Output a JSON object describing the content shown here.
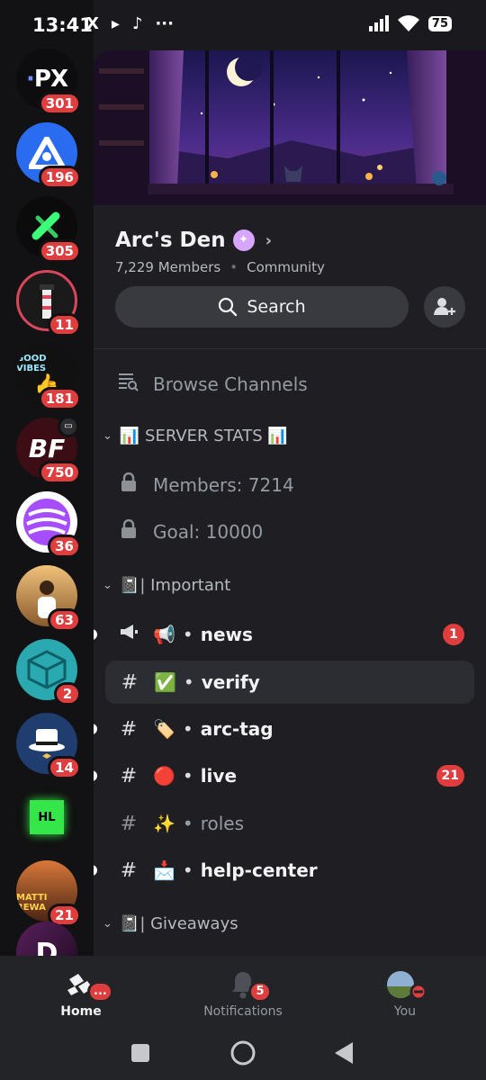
{
  "status_bar": {
    "time": "13:41",
    "left_icons": [
      "X",
      "▸",
      "♪",
      "···"
    ],
    "battery": "75"
  },
  "servers": [
    {
      "name": "server-px",
      "label": "PX",
      "badge": "301",
      "color": "#0d0d10"
    },
    {
      "name": "server-blue-triangle",
      "label": "",
      "badge": "196",
      "color": "#2a6cf0"
    },
    {
      "name": "server-green-x",
      "label": "",
      "badge": "305",
      "color": "#0b0b0b"
    },
    {
      "name": "server-lighthouse",
      "label": "",
      "badge": "11",
      "color": "#1a1a1a"
    },
    {
      "name": "server-good-vibes",
      "label": "GOOD VIBES",
      "badge": "181",
      "color": "#111"
    },
    {
      "name": "server-bf",
      "label": "BF",
      "badge": "750",
      "color": "#3b0d14"
    },
    {
      "name": "server-purple-waves",
      "label": "",
      "badge": "36",
      "color": "#ffffff"
    },
    {
      "name": "server-photo-person",
      "label": "",
      "badge": "63",
      "color": "#c98b4a"
    },
    {
      "name": "server-teal-cube",
      "label": "",
      "badge": "2",
      "color": "#2aa9b0"
    },
    {
      "name": "server-top-hat",
      "label": "",
      "badge": "14",
      "color": "#1f3d6e"
    },
    {
      "name": "server-hl",
      "label": "HL",
      "badge": "",
      "color": "#101010"
    },
    {
      "name": "server-matti",
      "label": "MATTI REWA",
      "badge": "21",
      "color": "#6b3a22"
    },
    {
      "name": "server-d",
      "label": "D",
      "badge": "",
      "color": "#2a0d2e"
    }
  ],
  "server": {
    "name": "Arc's Den",
    "members": "7,229 Members",
    "type": "Community",
    "search_label": "Search",
    "browse_label": "Browse Channels"
  },
  "categories": [
    {
      "label": "📊 SERVER STATS 📊"
    },
    {
      "label": "📓| Important"
    },
    {
      "label": "📓| Giveaways"
    }
  ],
  "channels": [
    {
      "label": "Members: 7214",
      "type": "locked-voice"
    },
    {
      "label": "Goal: 10000",
      "type": "locked-voice"
    },
    {
      "label": "news",
      "emoji": "📢",
      "type": "announcement",
      "badge": "1"
    },
    {
      "label": "verify",
      "emoji": "✅",
      "type": "text"
    },
    {
      "label": "arc-tag",
      "emoji": "🏷️",
      "type": "text"
    },
    {
      "label": "live",
      "emoji": "🔴",
      "type": "locked-text",
      "badge": "21"
    },
    {
      "label": "roles",
      "emoji": "✨",
      "type": "text"
    },
    {
      "label": "help-center",
      "emoji": "📩",
      "type": "text"
    }
  ],
  "bottom_nav": {
    "home": "Home",
    "home_badge": "...",
    "notifications": "Notifications",
    "notifications_badge": "5",
    "you": "You"
  }
}
